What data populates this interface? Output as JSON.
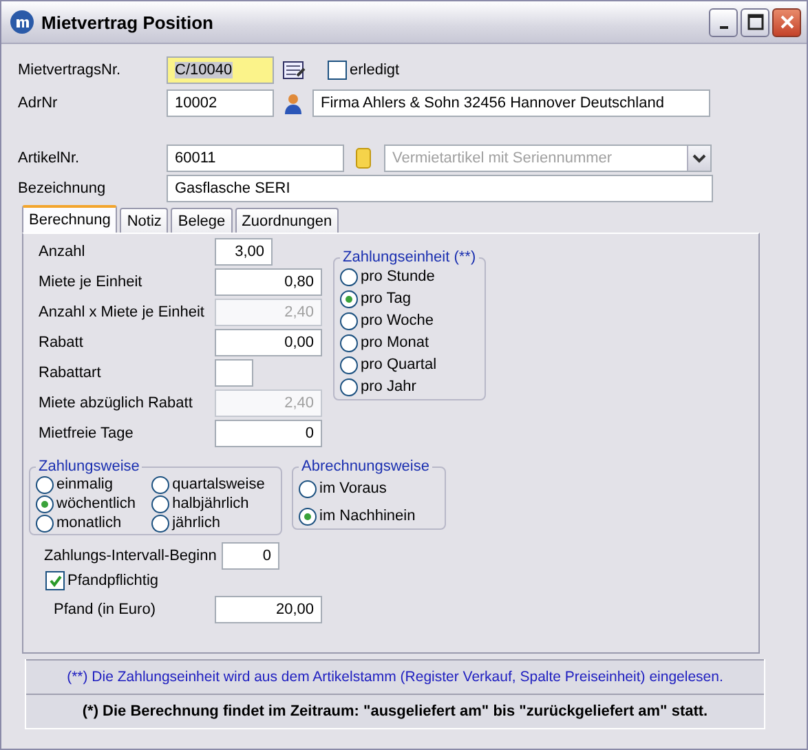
{
  "window": {
    "title": "Mietvertrag Position"
  },
  "header": {
    "contract": {
      "label": "MietvertragsNr.",
      "value": "C/10040"
    },
    "done": {
      "label": "erledigt",
      "checked": false
    },
    "address": {
      "label": "AdrNr",
      "value": "10002",
      "name": "Firma Ahlers & Sohn 32456 Hannover Deutschland"
    },
    "article": {
      "label": "ArtikelNr.",
      "value": "60011",
      "type": "Vermietartikel mit Seriennummer"
    },
    "description": {
      "label": "Bezeichnung",
      "value": "Gasflasche SERI"
    }
  },
  "tabs": [
    {
      "label": "Berechnung",
      "selected": true
    },
    {
      "label": "Notiz",
      "selected": false
    },
    {
      "label": "Belege",
      "selected": false
    },
    {
      "label": "Zuordnungen",
      "selected": false
    }
  ],
  "calc_fields": [
    {
      "label": "Anzahl",
      "value": "3,00",
      "disabled": false,
      "kind": "short"
    },
    {
      "label": "Miete je Einheit",
      "value": "0,80",
      "disabled": false,
      "kind": "normal"
    },
    {
      "label": "Anzahl x Miete je Einheit",
      "value": "2,40",
      "disabled": true,
      "kind": "normal"
    },
    {
      "label": "Rabatt",
      "value": "0,00",
      "disabled": false,
      "kind": "normal"
    },
    {
      "label": "Rabattart",
      "disabled": false,
      "kind": "tiny"
    },
    {
      "label": "Miete abzüglich Rabatt",
      "value": "2,40",
      "disabled": true,
      "kind": "normal"
    },
    {
      "label": "Mietfreie Tage",
      "value": "0",
      "disabled": false,
      "kind": "normal"
    }
  ],
  "payment_unit": {
    "title": "Zahlungseinheit (**)",
    "options": [
      {
        "label": "pro Stunde",
        "selected": false
      },
      {
        "label": "pro Tag",
        "selected": true
      },
      {
        "label": "pro Woche",
        "selected": false
      },
      {
        "label": "pro Monat",
        "selected": false
      },
      {
        "label": "pro Quartal",
        "selected": false
      },
      {
        "label": "pro Jahr",
        "selected": false
      }
    ]
  },
  "payment_mode": {
    "title": "Zahlungsweise",
    "options": [
      {
        "label": "einmalig",
        "selected": false
      },
      {
        "label": "wöchentlich",
        "selected": true
      },
      {
        "label": "monatlich",
        "selected": false
      },
      {
        "label": "quartalsweise",
        "selected": false
      },
      {
        "label": "halbjährlich",
        "selected": false
      },
      {
        "label": "jährlich",
        "selected": false
      }
    ]
  },
  "billing_mode": {
    "title": "Abrechnungsweise",
    "options": [
      {
        "label": "im Voraus",
        "selected": false
      },
      {
        "label": "im Nachhinein",
        "selected": true
      }
    ]
  },
  "interval_start": {
    "label": "Zahlungs-Intervall-Beginn",
    "value": "0"
  },
  "deposit_required": {
    "label": "Pfandpflichtig",
    "checked": true
  },
  "deposit": {
    "label": "Pfand (in Euro)",
    "value": "20,00"
  },
  "notes": [
    {
      "text": "(**) Die Zahlungseinheit wird aus dem Artikelstamm (Register Verkauf, Spalte Preiseinheit) eingelesen.",
      "kind": "info"
    },
    {
      "text": "(*) Die Berechnung findet im Zeitraum: \"ausgeliefert am\" bis \"zurückgeliefert am\" statt.",
      "kind": "bold"
    }
  ]
}
